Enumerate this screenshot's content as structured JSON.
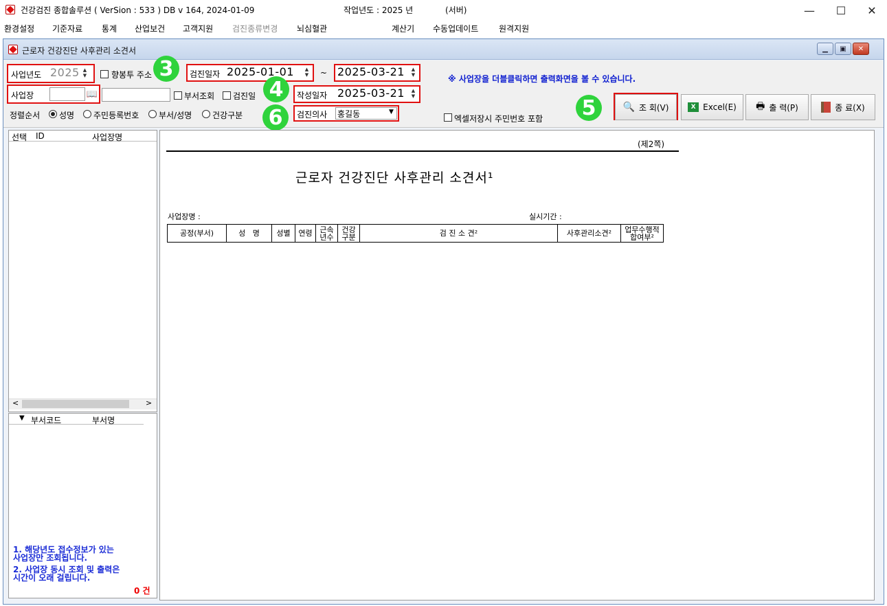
{
  "app": {
    "title": "건강검진 종합솔루션 ( VerSion : 533 ) DB v 164,   2024-01-09",
    "work_year": "작업년도 : 2025 년",
    "server": "(서버)",
    "controls": {
      "minimize": "—",
      "maximize": "☐",
      "close": "✕"
    }
  },
  "menu": [
    {
      "label": "환경설정"
    },
    {
      "label": "기준자료"
    },
    {
      "label": "통계"
    },
    {
      "label": "산업보건"
    },
    {
      "label": "고객지원"
    },
    {
      "label": "검진종류변경"
    },
    {
      "label": "뇌심혈관"
    },
    {
      "label": "계산기"
    },
    {
      "label": "수동업데이트"
    },
    {
      "label": "원격지원"
    }
  ],
  "window": {
    "title": "근로자 건강진단 사후관리 소견서"
  },
  "form": {
    "year_label": "사업년도",
    "year_value": "2025",
    "hangbong_label": "향봉투 주소",
    "site_label": "사업장",
    "site_value": "",
    "dept_query_label": "부서조회",
    "exam_date_check_label": "검진일",
    "sort_label": "정렬순서",
    "sort_options": [
      "성명",
      "주민등록번호",
      "부서/성명",
      "건강구분"
    ],
    "exam_date_label": "검진일자",
    "exam_date_from": "2025-01-01",
    "tilde": "~",
    "exam_date_to": "2025-03-21",
    "write_date_label": "작성일자",
    "write_date_value": "2025-03-21",
    "doctor_label": "검진의사",
    "doctor_value": "홍길동",
    "notice": "※ 사업장을 더블클릭하면 출력화면을 볼 수 있습니다.",
    "excel_ssn_label": "엑셀저장시 주민번호 포함"
  },
  "badges": {
    "b3": "3",
    "b4": "4",
    "b5": "5",
    "b6": "6"
  },
  "buttons": {
    "search": "조 회(V)",
    "excel": "Excel(E)",
    "print": "출 력(P)",
    "exit": "종 료(X)"
  },
  "site_list": {
    "headers": [
      "선택",
      "ID",
      "사업장명"
    ]
  },
  "dept_list": {
    "headers": [
      "▼",
      "부서코드",
      "부서명"
    ]
  },
  "notes": {
    "note1_line1": "1. 해당년도 접수정보가 있는",
    "note1_line2": "사업장만 조회됩니다.",
    "note2_line1": "2. 사업장 동시 조회 및 출력은",
    "note2_line2": "시간이 오래 걸립니다.",
    "count": "0 건"
  },
  "report": {
    "page": "(제2쪽)",
    "title": "근로자 건강진단 사후관리 소견서¹",
    "site_name_label": "사업장명 :",
    "period_label": "실시기간 :",
    "table_headers": [
      "공정(부서)",
      "성   명",
      "성별",
      "연령",
      "근속\n년수",
      "건강\n구분",
      "검 진 소 견²",
      "사후관리소견²",
      "업무수행적\n합여부²"
    ]
  },
  "colors": {
    "red_box": "#e01010",
    "badge_green": "#2fd33c",
    "notice_blue": "#1020d0"
  }
}
